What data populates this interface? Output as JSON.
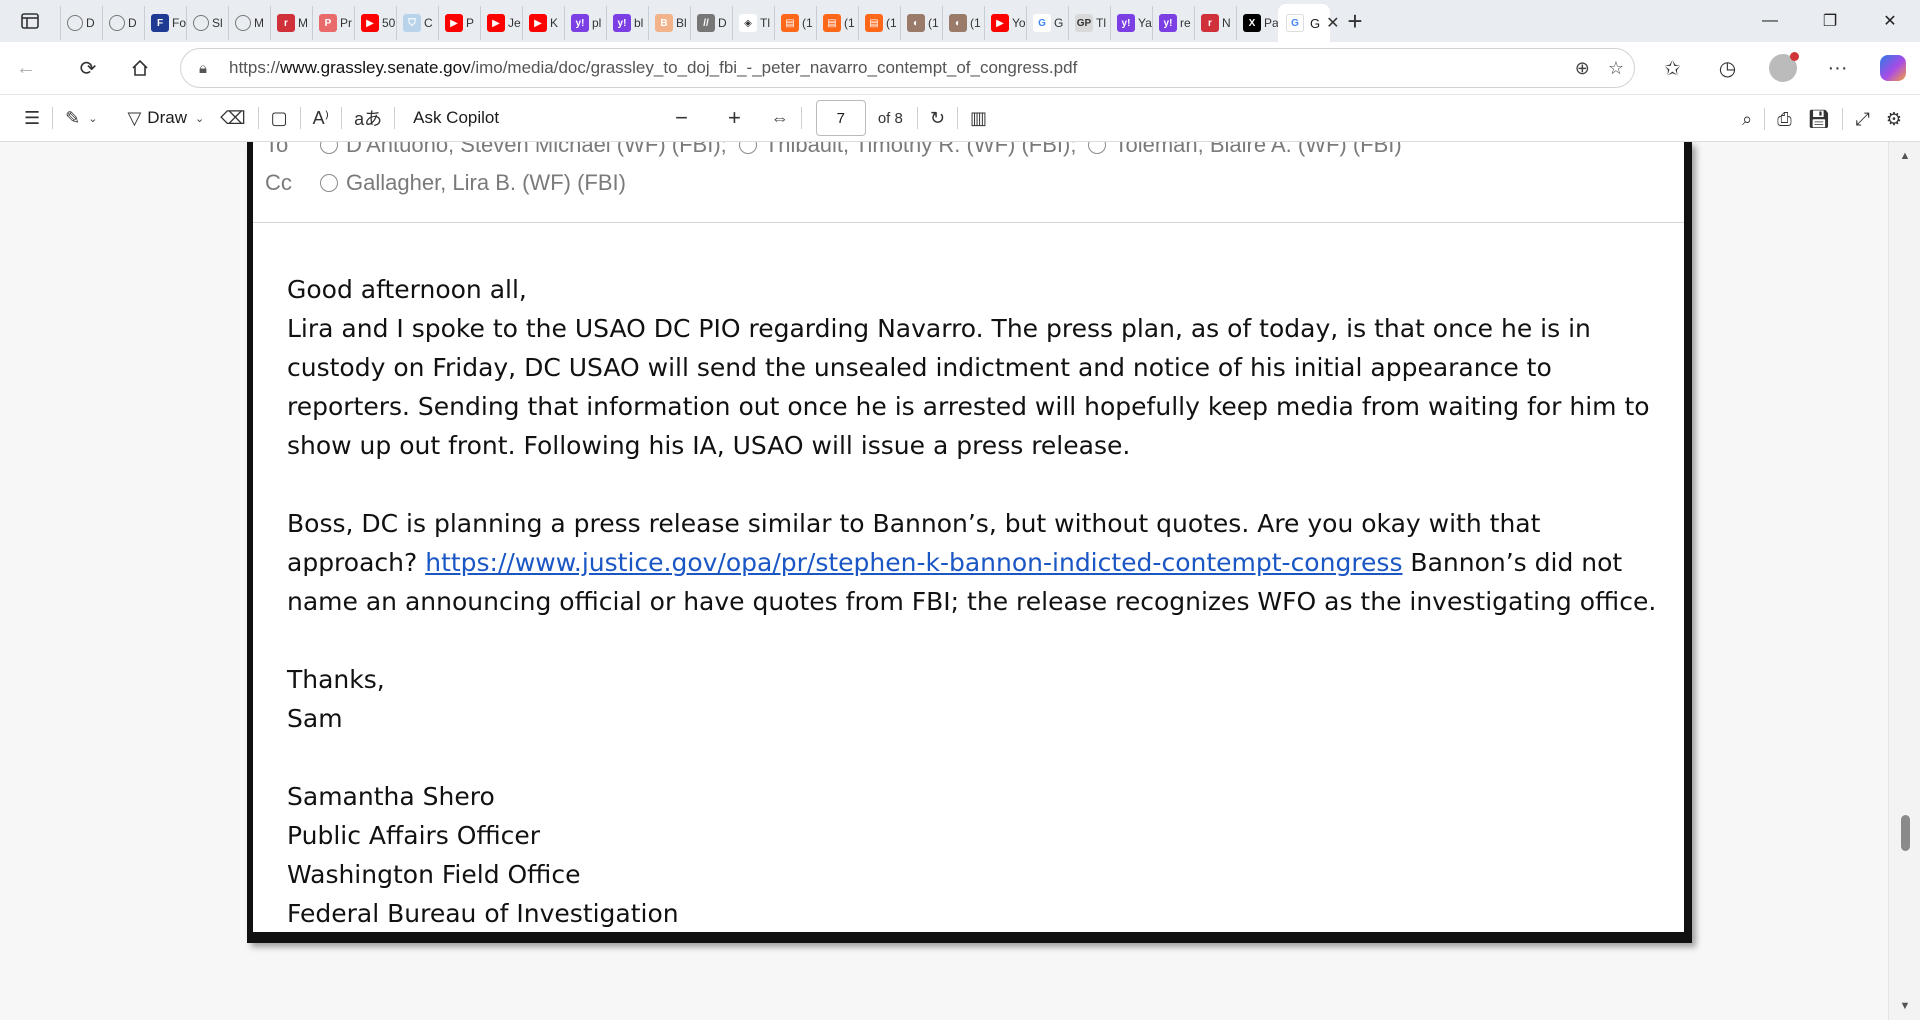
{
  "tabs": {
    "items": [
      {
        "label": "D",
        "icon": "globe-icon"
      },
      {
        "label": "D",
        "icon": "globe-icon"
      },
      {
        "label": "Fo",
        "icon": "foxnews-icon"
      },
      {
        "label": "Sl",
        "icon": "globe-icon"
      },
      {
        "label": "M",
        "icon": "globe-icon"
      },
      {
        "label": "M",
        "icon": "r-icon"
      },
      {
        "label": "Pr",
        "icon": "pdf-icon"
      },
      {
        "label": "50",
        "icon": "youtube-icon"
      },
      {
        "label": "C",
        "icon": "shield-icon"
      },
      {
        "label": "P",
        "icon": "youtube-icon"
      },
      {
        "label": "Je",
        "icon": "youtube-icon"
      },
      {
        "label": "K",
        "icon": "youtube-icon"
      },
      {
        "label": "pl",
        "icon": "yahoo-icon"
      },
      {
        "label": "bl",
        "icon": "yahoo-icon"
      },
      {
        "label": "Bl",
        "icon": "b-icon"
      },
      {
        "label": "D",
        "icon": "rss-icon"
      },
      {
        "label": "Tl",
        "icon": "diamond-icon"
      },
      {
        "label": "(1",
        "icon": "substack-icon"
      },
      {
        "label": "(1",
        "icon": "substack-icon"
      },
      {
        "label": "(1",
        "icon": "substack-icon"
      },
      {
        "label": "(1",
        "icon": "photo-icon"
      },
      {
        "label": "(1",
        "icon": "photo-icon"
      },
      {
        "label": "Yo",
        "icon": "youtube-icon"
      },
      {
        "label": "G",
        "icon": "google-icon"
      },
      {
        "label": "Tl",
        "icon": "gp-icon"
      },
      {
        "label": "Ya",
        "icon": "yahoo-icon"
      },
      {
        "label": "re",
        "icon": "yahoo-icon"
      },
      {
        "label": "N",
        "icon": "r-icon"
      },
      {
        "label": "Pa",
        "icon": "x-icon"
      }
    ],
    "active": {
      "label": "G",
      "icon": "google-icon"
    }
  },
  "address": {
    "url_prefix": "https://",
    "url_host": "www.grassley.senate.gov",
    "url_path": "/imo/media/doc/grassley_to_doj_fbi_-_peter_navarro_contempt_of_congress.pdf"
  },
  "pdf_toolbar": {
    "draw_label": "Draw",
    "ask_copilot_label": "Ask Copilot",
    "page_current": "7",
    "page_total": "of 8"
  },
  "email": {
    "to_label": "To",
    "to_recipients": [
      "D'Antuono, Steven Michael (WF) (FBI);",
      "Thibault, Timothy R. (WF) (FBI);",
      "Toleman, Blaire A. (WF) (FBI)"
    ],
    "cc_label": "Cc",
    "cc_recipients": [
      "Gallagher, Lira B. (WF) (FBI)"
    ],
    "greeting": "Good afternoon all,",
    "para1": "Lira and I spoke to the USAO DC PIO regarding Navarro. The press plan, as of today, is that once he is in custody on Friday, DC USAO will send the unsealed indictment and notice of his initial appearance to reporters.  Sending that information out once he is arrested will hopefully keep media from waiting for him to show up out front. Following his IA, USAO will issue a press release.",
    "para2_start": "Boss, DC is planning a press release similar to Bannon’s, but without quotes. Are you okay with that approach?",
    "para2_link": "https://www.justice.gov/opa/pr/stephen-k-bannon-indicted-contempt-congress",
    "para2_end": " Bannon’s did not name an announcing official or have quotes from FBI; the release recognizes WFO as the investigating office.",
    "thanks": "Thanks,",
    "sender_short": "Sam",
    "sig_name": "Samantha Shero",
    "sig_title": "Public Affairs Officer",
    "sig_office": "Washington Field Office",
    "sig_org": "Federal Bureau of Investigation"
  },
  "colors": {
    "link": "#1a56c4",
    "youtube": "#ff0000",
    "yahoo": "#7b3fe4",
    "substack": "#ff6719"
  }
}
